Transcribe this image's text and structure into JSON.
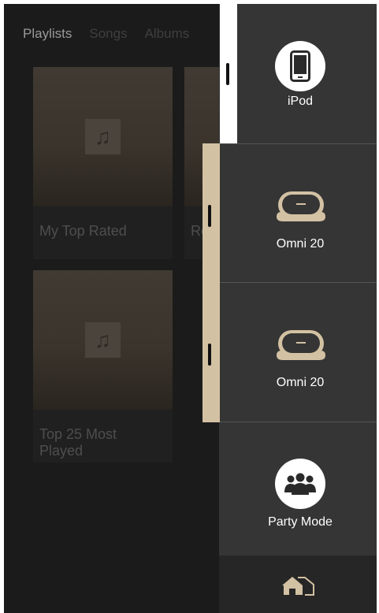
{
  "tabs": [
    "Playlists",
    "Songs",
    "Albums"
  ],
  "playlists": [
    {
      "title": "My Top Rated"
    },
    {
      "title": "Re"
    },
    {
      "title": "Top 25 Most\nPlayed"
    }
  ],
  "devices": [
    {
      "label": "iPod",
      "icon": "ipod-icon"
    },
    {
      "label": "Omni 20",
      "icon": "speaker-icon"
    },
    {
      "label": "Omni 20",
      "icon": "speaker-icon"
    },
    {
      "label": "Party Mode",
      "icon": "party-mode-icon"
    }
  ],
  "home": {
    "icon": "home-icon"
  },
  "colors": {
    "accent_tan": "#d3c1a3",
    "panel": "#353535",
    "background": "#1b1b1b"
  }
}
